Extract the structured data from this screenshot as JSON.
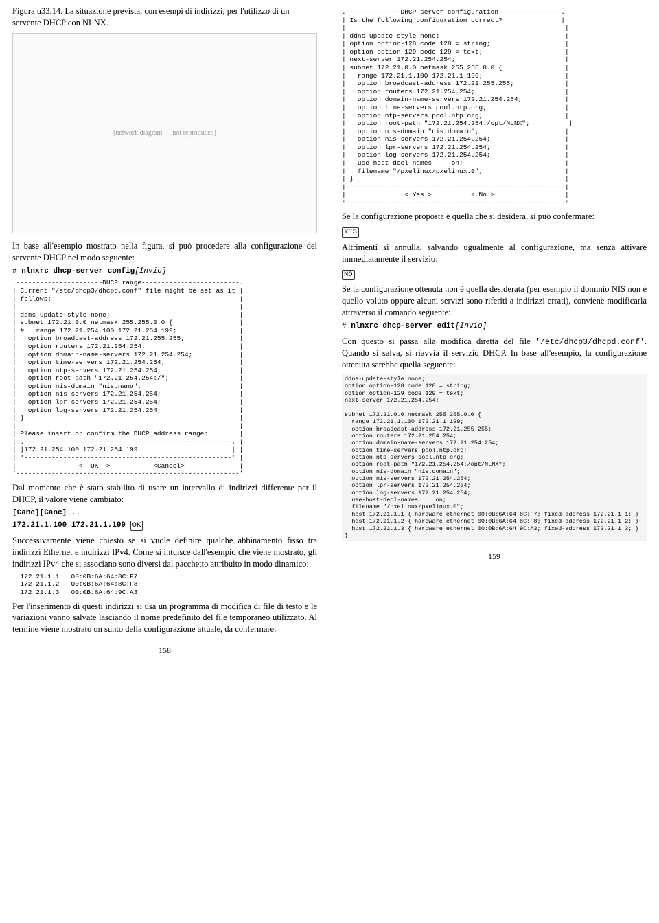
{
  "left": {
    "fig_caption": "Figura u33.14. La situazione prevista, con esempi di indirizzi, per l'utilizzo di un servente DHCP con NLNX.",
    "diagram_label": "[network diagram — not reproduced]",
    "para1": "In base all'esempio mostrato nella figura, si può procedere alla configurazione del servente DHCP nel modo seguente:",
    "cmd1_prefix": "# ",
    "cmd1": "nlnxrc dhcp-server config",
    "cmd1_invio": "[Invio]",
    "preA": ".----------------------DHCP range-------------------------.\n| Current \"/etc/dhcp3/dhcpd.conf\" file might be set as it |\n| follows:                                                |\n|                                                         |\n| ddns-update-style none;                                 |\n| subnet 172.21.0.0 netmask 255.255.0.0 {                 |\n| #   range 172.21.254.100 172.21.254.199;                |\n|   option broadcast-address 172.21.255.255;              |\n|   option routers 172.21.254.254;                        |\n|   option domain-name-servers 172.21.254.254;            |\n|   option time-servers 172.21.254.254;                   |\n|   option ntp-servers 172.21.254.254;                    |\n|   option root-path \"172.21.254.254:/\";                  |\n|   option nis-domain \"nis.nano\";                         |\n|   option nis-servers 172.21.254.254;                    |\n|   option lpr-servers 172.21.254.254;                    |\n|   option log-servers 172.21.254.254;                    |\n| }                                                       |\n|                                                         |\n| Please insert or confirm the DHCP address range:        |\n| .-----------------------------------------------------. |\n| |172.21.254.100 172.21.254.199                        | |\n| '-----------------------------------------------------' |\n|                <  OK  >           <Cancel>              |\n'---------------------------------------------------------'",
    "para2": "Dal momento che è stato stabilito di usare un intervallo di indirizzi differente per il DHCP, il valore viene cambiato:",
    "cmd2a": "[Canc][Canc]",
    "cmd2a_suffix": "...",
    "cmd2b": "172.21.1.100 172.21.1.199",
    "cmd2b_key": "OK",
    "para3": "Successivamente viene chiesto se si vuole definire qualche abbinamento fisso tra indirizzi Ethernet e indirizzi IPv4. Come si intuisce dall'esempio che viene mostrato, gli indirizzi IPv4 che si associano sono diversi dal pacchetto attribuito in modo dinamico:",
    "preB": "  172.21.1.1   00:0B:6A:64:8C:F7\n  172.21.1.2   00:0B:6A:64:8C:F8\n  172.21.1.3   00:0B:6A:64:9C:A3",
    "para4": "Per l'inserimento di questi indirizzi si usa un programma di modifica di file di testo e le variazioni vanno salvate lasciando il nome predefinito del file temporaneo utilizzato. Al termine viene mostrato un sunto della configurazione attuale, da confermare:",
    "pagenum": "158"
  },
  "right": {
    "preC": ".--------------DHCP server configuration----------------.\n| Is the following configuration correct?               |\n|                                                        |\n| ddns-update-style none;                                |\n| option option-128 code 128 = string;                   |\n| option option-129 code 129 = text;                     |\n| next-server 172.21.254.254;                            |\n| subnet 172.21.0.0 netmask 255.255.0.0 {                |\n|   range 172.21.1.100 172.21.1.199;                     |\n|   option broadcast-address 172.21.255.255;             |\n|   option routers 172.21.254.254;                       |\n|   option domain-name-servers 172.21.254.254;           |\n|   option time-servers pool.ntp.org;                    |\n|   option ntp-servers pool.ntp.org;                     |\n|   option root-path \"172.21.254.254:/opt/NLNX\";          |\n|   option nis-domain \"nis.domain\";                      |\n|   option nis-servers 172.21.254.254;                   |\n|   option lpr-servers 172.21.254.254;                   |\n|   option log-servers 172.21.254.254;                   |\n|   use-host-decl-names     on;                          |\n|   filename \"/pxelinux/pxelinux.0\";                     |\n| }                                                      |\n|--------------------------------------------------------|\n|               < Yes >          < No >                  |\n'--------------------------------------------------------'",
    "para1": "Se la configurazione proposta è quella che si desidera, si può confermare:",
    "key1": "YES",
    "para2": "Altrimenti si annulla, salvando ugualmente al configurazione, ma senza attivare immediatamente il servizio:",
    "key2": "NO",
    "para3a": "Se la configurazione ottenuta non è quella desiderata (per esempio il dominio NIS non è quello voluto oppure alcuni servizi sono riferiti a indirizzi errati), conviene modificarla attraverso il comando seguente:",
    "cmd3_prefix": "# ",
    "cmd3": "nlnxrc dhcp-server edit",
    "cmd3_invio": "[Invio]",
    "para3b_a": "Con questo si passa alla modifica diretta del file ",
    "mono1": "'/etc/dhcp3/dhcpd.conf'",
    "para3b_b": ". Quando si salva, si riavvia il servizio DHCP. In base all'esempio, la configurazione ottenuta sarebbe quella seguente:",
    "preD": "ddns-update-style none;\noption option-128 code 128 = string;\noption option-129 code 129 = text;\nnext-server 172.21.254.254;\n\nsubnet 172.21.0.0 netmask 255.255.0.0 {\n  range 172.21.1.100 172.21.1.199;\n  option broadcast-address 172.21.255.255;\n  option routers 172.21.254.254;\n  option domain-name-servers 172.21.254.254;\n  option time-servers pool.ntp.org;\n  option ntp-servers pool.ntp.org;\n  option root-path \"172.21.254.254:/opt/NLNX\";\n  option nis-domain \"nis.domain\";\n  option nis-servers 172.21.254.254;\n  option lpr-servers 172.21.254.254;\n  option log-servers 172.21.254.254;\n  use-host-decl-names     on;\n  filename \"/pxelinux/pxelinux.0\";\n  host 172.21.1.1 { hardware ethernet 00:0B:6A:64:8C:F7; fixed-address 172.21.1.1; }\n  host 172.21.1.2 { hardware ethernet 00:0B:6A:64:8C:F8; fixed-address 172.21.1.2; }\n  host 172.21.1.3 { hardware ethernet 00:0B:6A:64:9C:A3; fixed-address 172.21.1.3; }\n}",
    "pagenum": "159"
  }
}
